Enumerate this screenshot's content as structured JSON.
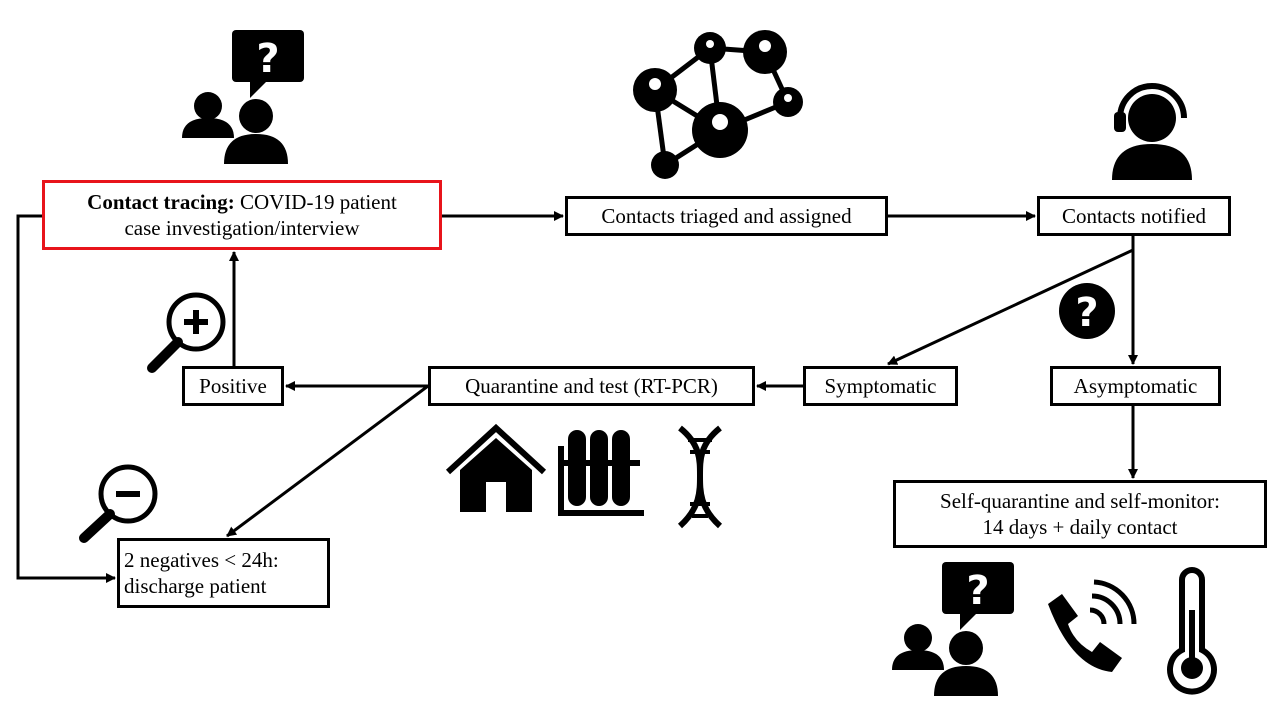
{
  "nodes": {
    "contact_tracing": {
      "bold": "Contact tracing:",
      "line1": " COVID-19 patient",
      "line2": "case investigation/interview",
      "border_color": "#e8141b"
    },
    "triaged": "Contacts triaged and assigned",
    "notified": "Contacts notified",
    "symptomatic": "Symptomatic",
    "asymptomatic": "Asymptomatic",
    "quarantine_test": "Quarantine and test (RT-PCR)",
    "positive": "Positive",
    "negatives": {
      "line1": "2 negatives < 24h:",
      "line2": "discharge patient"
    },
    "self_quarantine": {
      "line1": "Self-quarantine and self-monitor:",
      "line2": "14 days + daily contact"
    }
  },
  "icons": [
    "people-question-icon",
    "network-icon",
    "headset-agent-icon",
    "question-circle-icon",
    "magnifier-plus-icon",
    "magnifier-minus-icon",
    "house-icon",
    "test-tubes-icon",
    "dna-icon",
    "phone-icon",
    "thermometer-icon"
  ]
}
